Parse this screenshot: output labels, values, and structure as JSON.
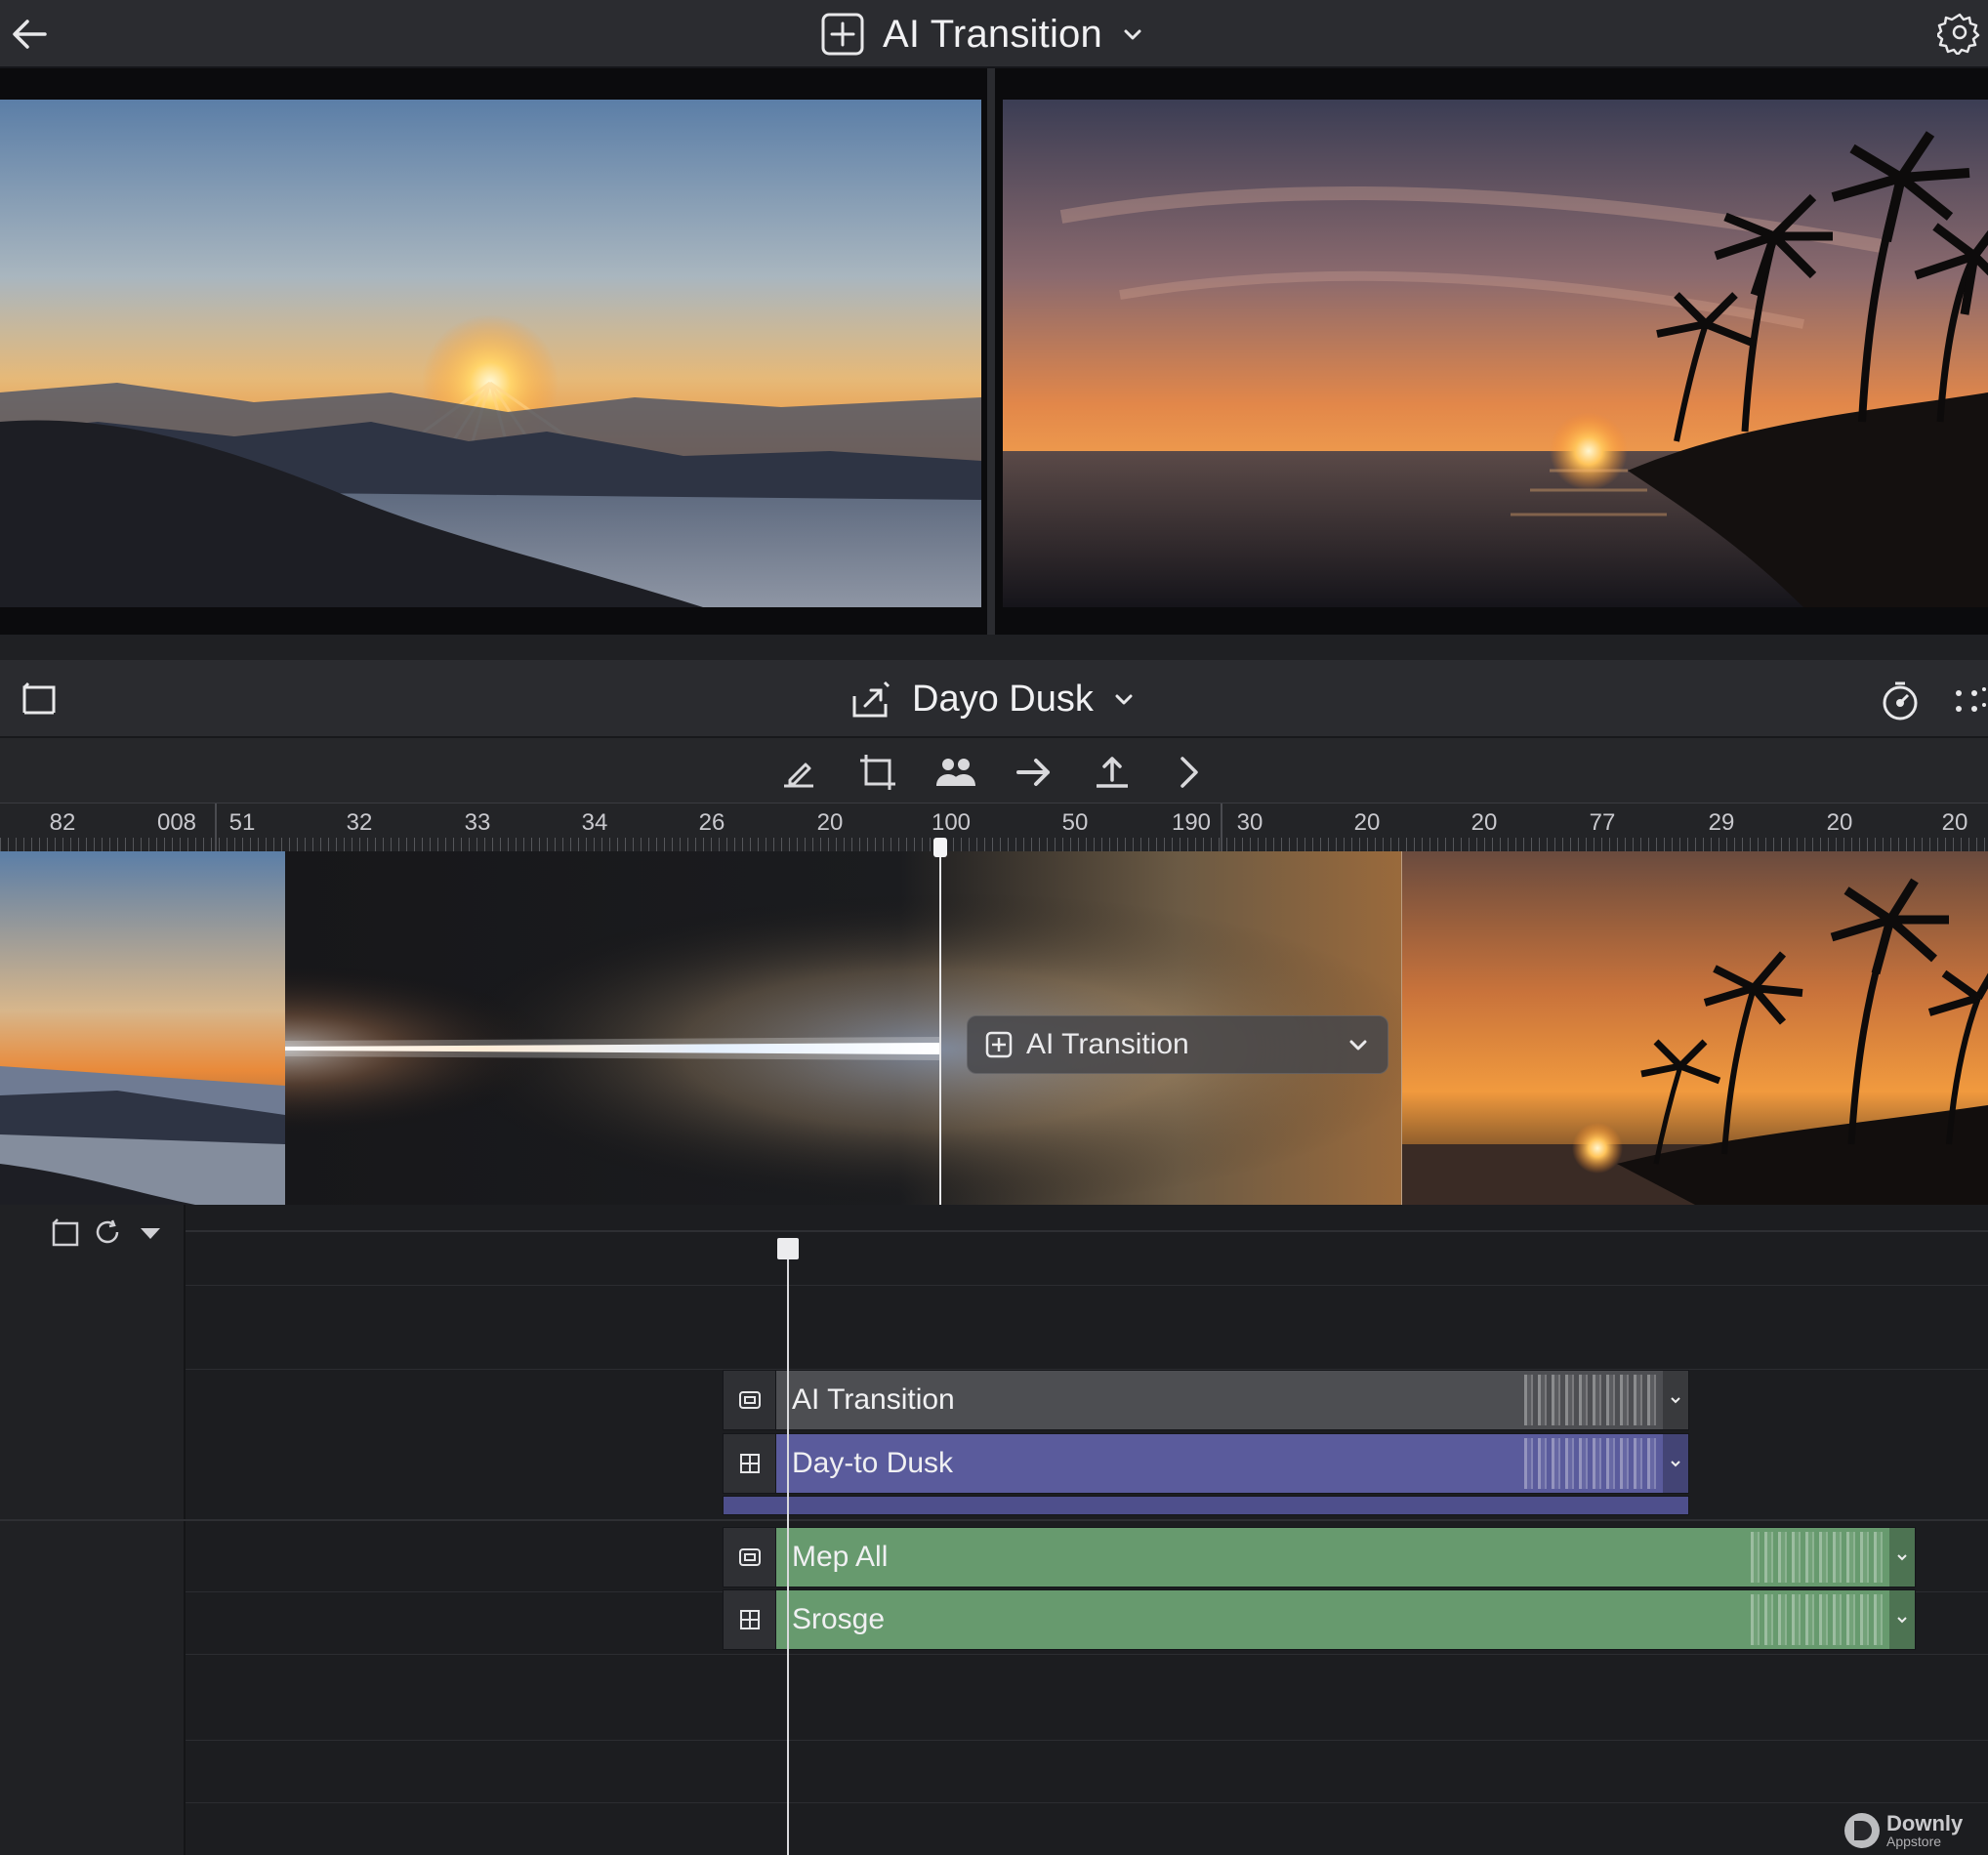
{
  "header": {
    "title": "AI Transition",
    "back_icon": "arrow-left-icon",
    "settings_icon": "gear-icon"
  },
  "preview": {
    "left_scene": "mountain-sunrise",
    "right_scene": "palm-beach-sunset"
  },
  "project": {
    "title": "Dayo Dusk"
  },
  "toolbar": {
    "tools": [
      "edit-icon",
      "crop-icon",
      "people-icon",
      "arrow-right-icon",
      "upload-icon",
      "chevron-right-icon"
    ]
  },
  "ruler": {
    "labels": [
      "82",
      "008",
      "51",
      "32",
      "33",
      "34",
      "26",
      "20",
      "100",
      "50",
      "190",
      "30",
      "20",
      "20",
      "77",
      "29",
      "20",
      "20"
    ]
  },
  "strip": {
    "transition_label": "AI Transition"
  },
  "timeline": {
    "tracks": [
      {
        "label": "AI Transition",
        "color": "#4d4e52"
      },
      {
        "label": "Day-to Dusk",
        "color": "#5a5b9c"
      },
      {
        "label": "Mep All",
        "color": "#679a6e"
      },
      {
        "label": "Srosge",
        "color": "#679a6e"
      }
    ]
  },
  "watermark": {
    "name": "Downly",
    "sub": "Appstore"
  }
}
